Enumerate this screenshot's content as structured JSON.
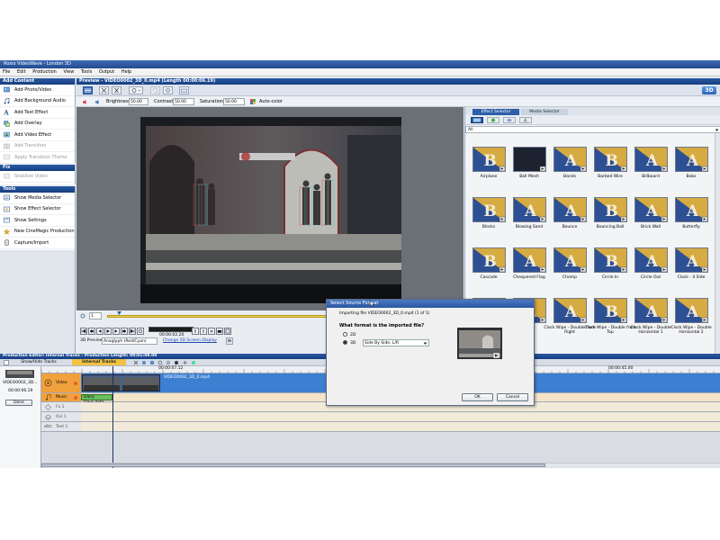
{
  "window": {
    "title": "Roxio VideoWave - London 3D"
  },
  "menu": [
    "File",
    "Edit",
    "Production",
    "View",
    "Tools",
    "Output",
    "Help"
  ],
  "add_content": {
    "header": "Add Content",
    "items": [
      {
        "label": "Add Photo/Video",
        "enabled": true,
        "icon": "photo-video-icon"
      },
      {
        "label": "Add Background Audio",
        "enabled": true,
        "icon": "audio-icon"
      },
      {
        "label": "Add Text Effect",
        "enabled": true,
        "icon": "text-effect-icon"
      },
      {
        "label": "Add Overlay",
        "enabled": true,
        "icon": "overlay-icon"
      },
      {
        "label": "Add Video Effect",
        "enabled": true,
        "icon": "video-effect-icon"
      },
      {
        "label": "Add Transition",
        "enabled": false,
        "icon": "transition-icon"
      },
      {
        "label": "Apply Transition Theme",
        "enabled": false,
        "icon": "transition-theme-icon"
      }
    ]
  },
  "fix": {
    "header": "Fix",
    "items": [
      {
        "label": "Stabilize Video",
        "enabled": false
      }
    ]
  },
  "tools": {
    "header": "Tools",
    "items": [
      {
        "label": "Show Media Selector"
      },
      {
        "label": "Show Effect Selector"
      },
      {
        "label": "Show Settings"
      },
      {
        "label": "New CineMagic Production"
      },
      {
        "label": "Capture/Import"
      }
    ]
  },
  "preview": {
    "header": "Preview - VIDEO0002_3D_0.mp4 (Length 00:00:06.19)",
    "brightness_label": "Brightness:",
    "brightness": "50.00",
    "contrast_label": "Contrast:",
    "contrast": "50.00",
    "saturation_label": "Saturation:",
    "saturation": "50.00",
    "autocolor_label": "Auto-color",
    "badge_3d": "3D",
    "frame_field": "1",
    "timecode": "00:00:02.20",
    "preview_mode_label": "3D Preview:",
    "preview_mode": "Anaglyph (Red/Cyan)",
    "change_screen_link": "Change 3D Screen Display"
  },
  "effect_panel": {
    "tabs": [
      "Effect Selector",
      "Media Selector"
    ],
    "filter": "All",
    "items": [
      {
        "label": "Airplane"
      },
      {
        "label": "Ball Mesh"
      },
      {
        "label": "Bands"
      },
      {
        "label": "Barbed Wire"
      },
      {
        "label": "Billboard"
      },
      {
        "label": "Bobs"
      },
      {
        "label": "Blocks"
      },
      {
        "label": "Blowing Sand"
      },
      {
        "label": "Bounce"
      },
      {
        "label": "Bouncing Ball"
      },
      {
        "label": "Brick Wall"
      },
      {
        "label": "Butterfly"
      },
      {
        "label": "Cascade"
      },
      {
        "label": "Chequered Flag"
      },
      {
        "label": "Chomp"
      },
      {
        "label": "Circle In"
      },
      {
        "label": "Circle Out"
      },
      {
        "label": "Clock - 4 Side"
      },
      {
        "label": ""
      },
      {
        "label": ""
      },
      {
        "label": "Clock Wipe - Double from Right"
      },
      {
        "label": "Clock Wipe - Double from Top"
      },
      {
        "label": "Clock Wipe - Double Horizontal 1"
      },
      {
        "label": "Clock Wipe - Double Horizontal 2"
      }
    ]
  },
  "production": {
    "header": "Production Editor: Internal Tracks - Production Length: 00:01:08.00",
    "show_hide_label": "Show/Hide Tracks",
    "internal_tracks_label": "Internal Tracks",
    "clip_name": "VIDEO0002_3D...",
    "clip_length": "00:00:06.19",
    "done_label": "Done",
    "ruler": [
      "00:00:07.12",
      "00:00:45.00"
    ],
    "tracks": [
      {
        "label": "Video",
        "clip": "VIDEO0002_3D_0.mp4"
      },
      {
        "label": "Music",
        "clip": "Glory Days.m4a"
      },
      {
        "label": "Fx 1"
      },
      {
        "label": "Ovl 1"
      },
      {
        "label": "Text 1",
        "prefix": "abc"
      }
    ]
  },
  "dialog": {
    "title": "Select Source Format",
    "importing": "Importing file VIDEO0002_3D_0.mp4 (1 of 1)",
    "question": "What format is the imported file?",
    "option_2d": "2D",
    "option_3d": "3D",
    "format_value": "Side By Side, L/R",
    "ok": "OK",
    "cancel": "Cancel"
  },
  "colors": {
    "header_blue": "#1f4d96",
    "timeline_blue": "#3d7fd1",
    "effect_gold": "#e9b53a",
    "music_orange": "#f0a13c"
  }
}
